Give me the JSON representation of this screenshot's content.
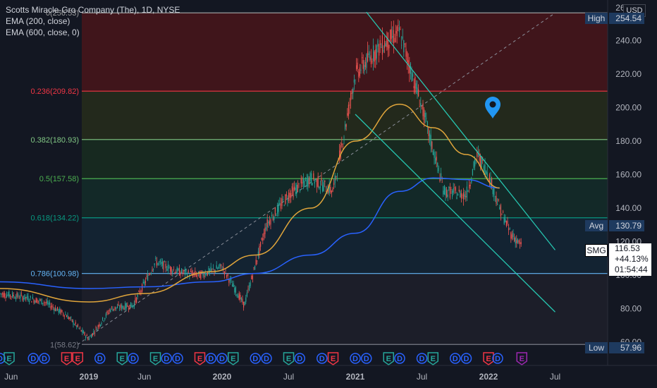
{
  "header": {
    "title": "Scotts Miracle-Gro Company (The), 1D, NYSE",
    "indicator1": "EMA (200, close)",
    "indicator2": "EMA (600, close, 0)",
    "currency": "USD"
  },
  "price_tags": {
    "high_label": "High",
    "high_value": "254.54",
    "avg_label": "Avg",
    "avg_value": "130.79",
    "low_label": "Low",
    "low_value": "57.96"
  },
  "last_price": {
    "symbol": "SMG",
    "price": "116.53",
    "change": "+44.13%",
    "countdown": "01:54:44"
  },
  "colors": {
    "background": "#131722",
    "candle_up": "#26a69a",
    "candle_down": "#ef5350",
    "ema200": "#2962ff",
    "ema600": "#e0a53b",
    "channel": "#26c6b0",
    "marker": "#2196f3"
  },
  "chart_data": {
    "type": "line",
    "symbol": "SMG",
    "timeframe": "1D",
    "exchange": "NYSE",
    "ylim": [
      57,
      262
    ],
    "y_ticks": [
      "240.00",
      "220.00",
      "200.00",
      "180.00",
      "160.00",
      "140.00",
      "120.00",
      "100.00",
      "80.00"
    ],
    "y_ticks_partial_top": "260.00",
    "y_ticks_partial_bottom": "60.00",
    "x_ticks": [
      "Jun",
      "2019",
      "Jun",
      "2020",
      "Jul",
      "2021",
      "Jul",
      "2022",
      "Jul"
    ],
    "fib_levels": [
      {
        "label": "0(256.53)",
        "price": 256.53,
        "color": "#9c9c9c"
      },
      {
        "label": "0.236(209.82)",
        "price": 209.82,
        "color": "#f23645"
      },
      {
        "label": "0.382(180.93)",
        "price": 180.93,
        "color": "#81c784"
      },
      {
        "label": "0.5(157.58)",
        "price": 157.58,
        "color": "#4caf50"
      },
      {
        "label": "0.618(134.22)",
        "price": 134.22,
        "color": "#089981"
      },
      {
        "label": "0.786(100.98)",
        "price": 100.98,
        "color": "#64b5f6"
      },
      {
        "label": "1(58.62)",
        "price": 58.62,
        "color": "#787b86"
      }
    ],
    "price_series": {
      "name": "",
      "x": [
        "2018-05",
        "2018-07",
        "2018-09",
        "2018-11",
        "2019-01",
        "2019-03",
        "2019-05",
        "2019-07",
        "2019-09",
        "2019-11",
        "2020-01",
        "2020-03",
        "2020-05",
        "2020-07",
        "2020-09",
        "2020-11",
        "2021-01",
        "2021-03",
        "2021-05",
        "2021-07",
        "2021-09",
        "2021-11",
        "2021-12",
        "2022-01",
        "2022-02",
        "2022-03",
        "2022-04"
      ],
      "values": [
        89,
        87,
        84,
        76,
        62,
        80,
        82,
        108,
        102,
        100,
        105,
        82,
        130,
        148,
        158,
        150,
        220,
        235,
        245,
        200,
        150,
        148,
        172,
        160,
        140,
        125,
        117
      ]
    },
    "ema200": {
      "x": [
        "2018-05",
        "2019-01",
        "2019-06",
        "2019-12",
        "2020-04",
        "2020-09",
        "2021-01",
        "2021-05",
        "2021-08",
        "2021-11",
        "2022-02"
      ],
      "values": [
        92,
        84,
        89,
        102,
        112,
        140,
        180,
        202,
        188,
        172,
        152
      ]
    },
    "ema600": {
      "x": [
        "2018-05",
        "2019-01",
        "2019-06",
        "2019-12",
        "2020-04",
        "2020-09",
        "2021-01",
        "2021-05",
        "2021-08",
        "2021-11",
        "2022-02"
      ],
      "values": [
        96,
        92,
        93,
        96,
        101,
        112,
        125,
        150,
        158,
        157,
        152
      ]
    },
    "channel_lines": [
      {
        "start": [
          "2021-02",
          257
        ],
        "end": [
          "2022-07",
          115
        ]
      },
      {
        "start": [
          "2021-01",
          196
        ],
        "end": [
          "2022-07",
          78
        ]
      }
    ],
    "trend_line": {
      "start": [
        "2018-12",
        58.6
      ],
      "end": [
        "2022-07",
        256.5
      ]
    },
    "earnings_markers": {
      "x": [
        "2018-05",
        "2018-05",
        "2018-08",
        "2018-09",
        "2018-11",
        "2018-12",
        "2019-02",
        "2019-04",
        "2019-05",
        "2019-07",
        "2019-08",
        "2019-09",
        "2019-11",
        "2019-12",
        "2020-01",
        "2020-02",
        "2020-04",
        "2020-05",
        "2020-07",
        "2020-08",
        "2020-10",
        "2020-11",
        "2021-01",
        "2021-02",
        "2021-04",
        "2021-05",
        "2021-07",
        "2021-08",
        "2021-10",
        "2021-11",
        "2022-01",
        "2022-01",
        "2022-04"
      ],
      "labels": [
        "D",
        "E",
        "D",
        "D",
        "E",
        "E",
        "D",
        "E",
        "D",
        "E",
        "D",
        "D",
        "E",
        "D",
        "D",
        "E",
        "D",
        "D",
        "E",
        "D",
        "D",
        "E",
        "D",
        "D",
        "E",
        "D",
        "D",
        "E",
        "D",
        "D",
        "E",
        "D",
        "E"
      ],
      "colors": [
        "#2962ff",
        "#26a69a",
        "#2962ff",
        "#2962ff",
        "#f23645",
        "#f23645",
        "#2962ff",
        "#26a69a",
        "#2962ff",
        "#26a69a",
        "#2962ff",
        "#2962ff",
        "#f23645",
        "#2962ff",
        "#2962ff",
        "#26a69a",
        "#2962ff",
        "#2962ff",
        "#26a69a",
        "#2962ff",
        "#2962ff",
        "#f23645",
        "#2962ff",
        "#2962ff",
        "#26a69a",
        "#2962ff",
        "#2962ff",
        "#26a69a",
        "#2962ff",
        "#2962ff",
        "#f23645",
        "#2962ff",
        "#9c27b0"
      ]
    }
  }
}
